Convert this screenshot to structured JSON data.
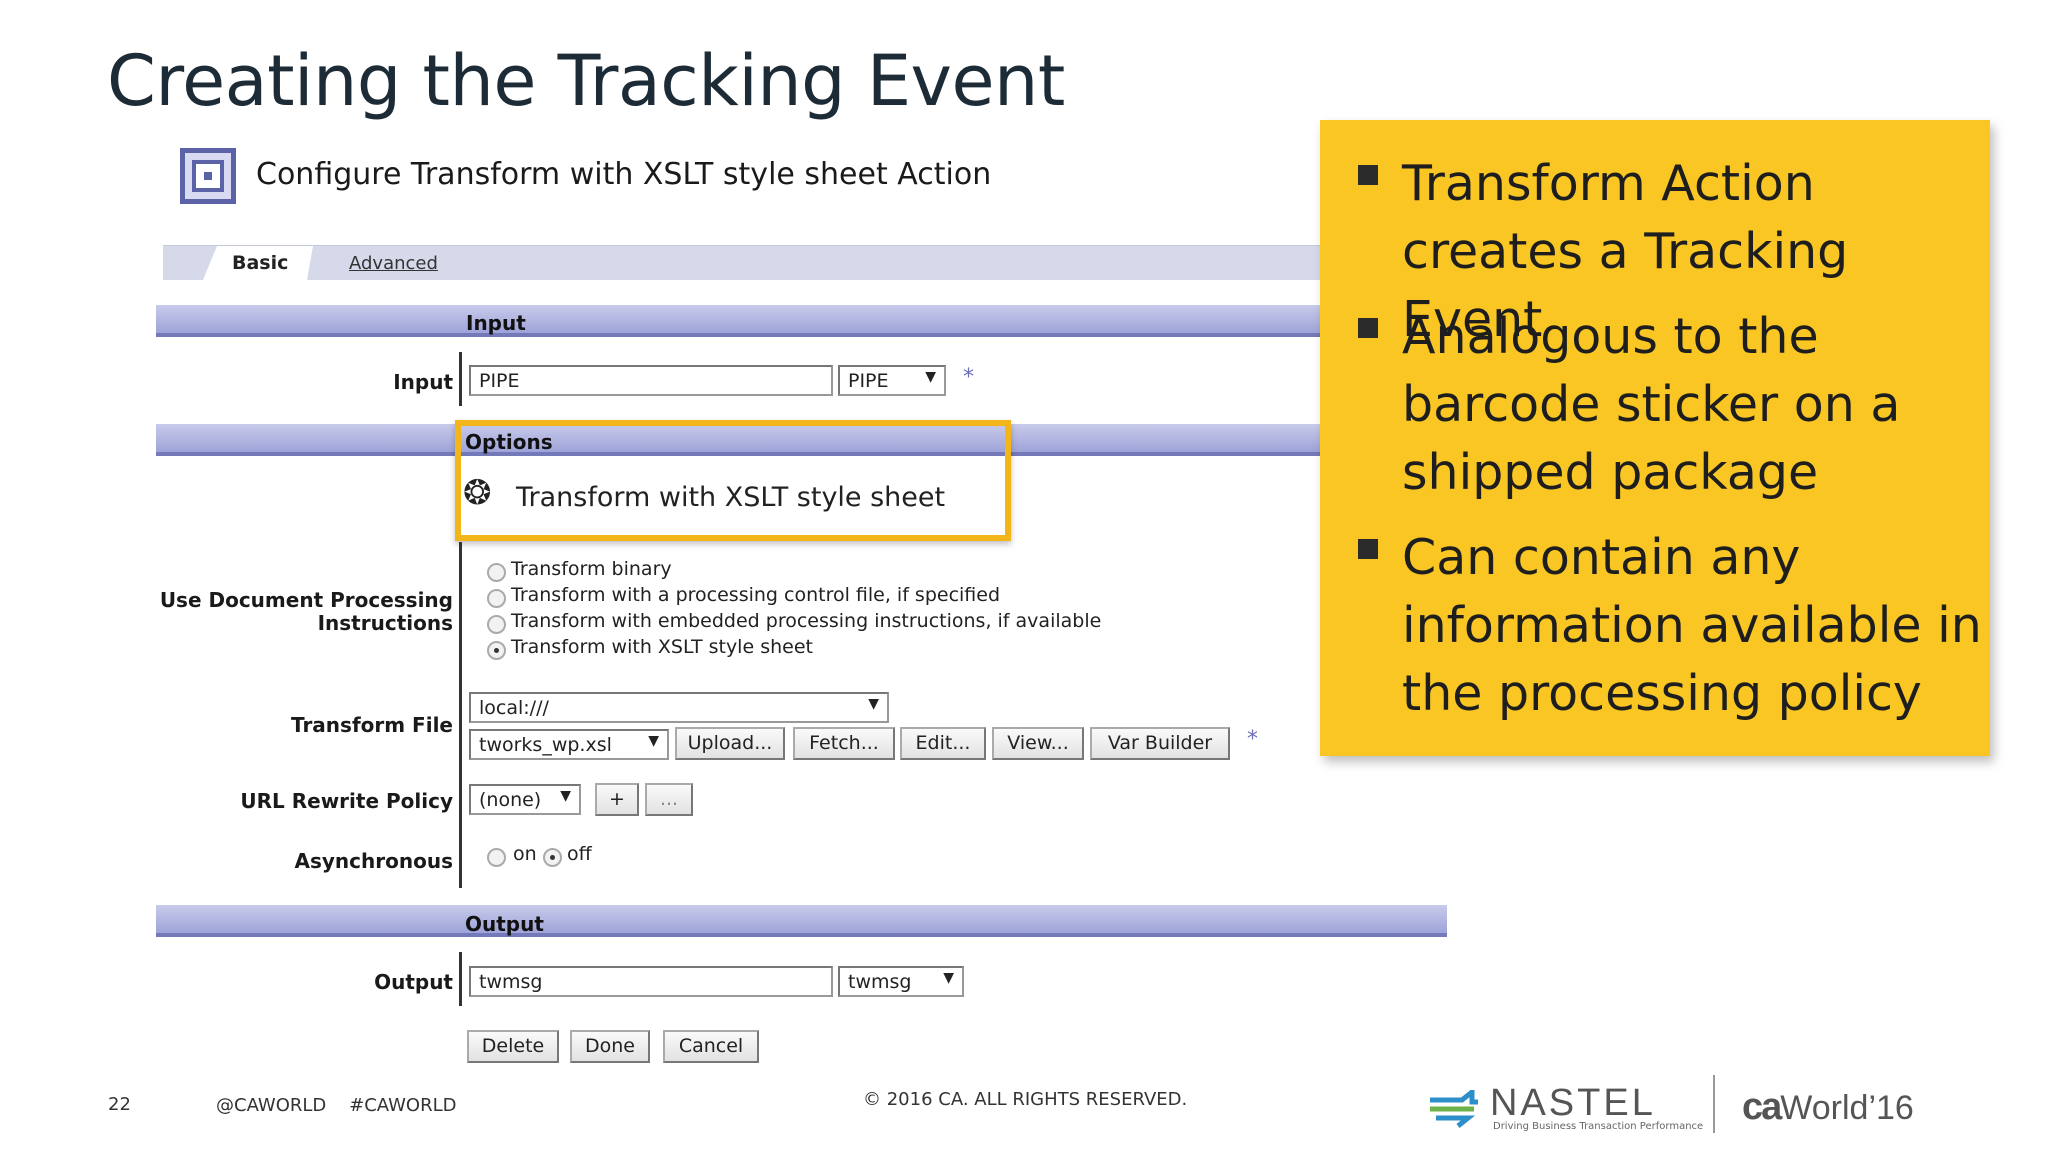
{
  "slide": {
    "title": "Creating the Tracking Event",
    "page_number": "22",
    "hashtags": "@CAWORLD    #CAWORLD",
    "copyright": "© 2016 CA. ALL RIGHTS RESERVED."
  },
  "dialog": {
    "title": "Configure Transform with XSLT style sheet Action",
    "tabs": [
      {
        "label": "Basic",
        "active": true
      },
      {
        "label": "Advanced",
        "active": false
      }
    ]
  },
  "sections": {
    "input": "Input",
    "options": "Options",
    "output": "Output"
  },
  "input_row": {
    "label": "Input",
    "value": "PIPE",
    "select_value": "PIPE",
    "required_mark": "*"
  },
  "options": {
    "transform_label": "Transform with XSLT style sheet",
    "use_doc_label_line1": "Use Document Processing",
    "use_doc_label_line2": "Instructions",
    "radio_options": [
      {
        "label": "Transform binary",
        "checked": false
      },
      {
        "label": "Transform with a processing control file, if specified",
        "checked": false
      },
      {
        "label": "Transform with embedded processing instructions, if available",
        "checked": false
      },
      {
        "label": "Transform with XSLT style sheet",
        "checked": true
      }
    ],
    "transform_file_label": "Transform File",
    "transform_file_location": "local:///",
    "transform_file_name": "tworks_wp.xsl",
    "file_buttons": [
      "Upload...",
      "Fetch...",
      "Edit...",
      "View...",
      "Var Builder"
    ],
    "required_mark": "*",
    "url_rewrite_label": "URL Rewrite Policy",
    "url_rewrite_value": "(none)",
    "url_add_button": "+",
    "url_more_button": "...",
    "async_label": "Asynchronous",
    "async_on": "on",
    "async_off": "off",
    "async_selected": "off"
  },
  "output_row": {
    "label": "Output",
    "value": "twmsg",
    "select_value": "twmsg"
  },
  "action_buttons": [
    "Delete",
    "Done",
    "Cancel"
  ],
  "callout": {
    "background": "#f9c623",
    "bullets": [
      "Transform Action creates a Tracking Event",
      "Analogous to the barcode sticker on a shipped package",
      "Can contain any information available in the processing policy"
    ]
  },
  "logos": {
    "nastel": "NASTEL",
    "nastel_tagline": "Driving Business Transaction Performance",
    "ca_world": "World’16",
    "ca_mark": "ca"
  }
}
